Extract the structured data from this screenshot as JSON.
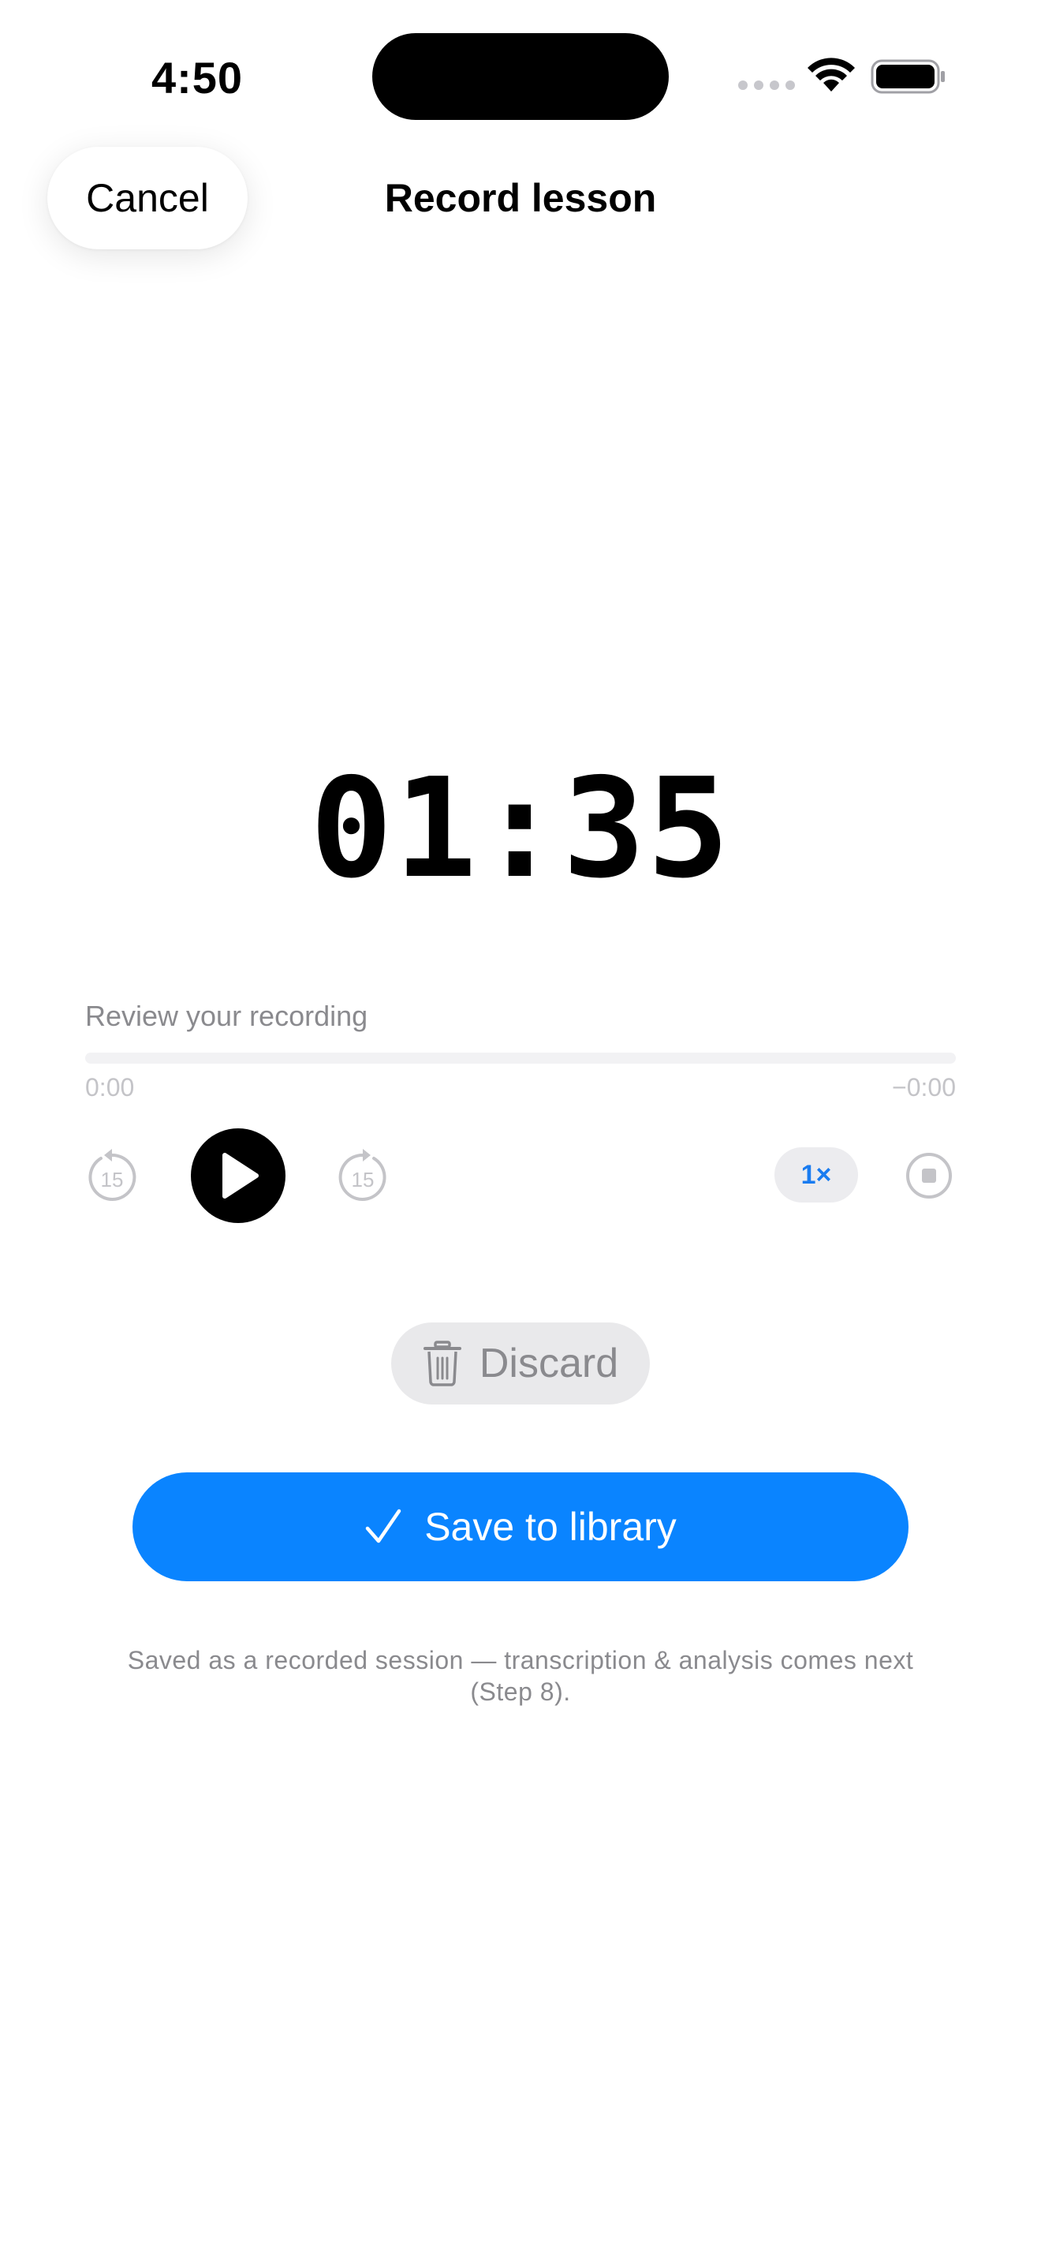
{
  "status_bar": {
    "time": "4:50",
    "icons": [
      "cellular-icon",
      "wifi-icon",
      "battery-icon"
    ]
  },
  "header": {
    "cancel_label": "Cancel",
    "title": "Record lesson"
  },
  "timer": {
    "value": "01:35"
  },
  "review": {
    "label": "Review your recording",
    "progress": 0,
    "time_elapsed": "0:00",
    "time_remaining": "−0:00",
    "skip_back_seconds": "15",
    "skip_forward_seconds": "15",
    "speed_label": "1×",
    "icons": [
      "skip-back-15-icon",
      "play-icon",
      "skip-forward-15-icon",
      "stop-icon"
    ]
  },
  "actions": {
    "discard_label": "Discard",
    "save_label": "Save to library",
    "icons": [
      "trash-icon",
      "checkmark-icon"
    ]
  },
  "footnote": "Saved as a recorded session — transcription & analysis comes next (Step 8).",
  "colors": {
    "accent": "#0a84ff",
    "speed_text": "#1a7cf0",
    "secondary_text": "#8a8a8e",
    "discard_bg": "#e9e9eb"
  }
}
